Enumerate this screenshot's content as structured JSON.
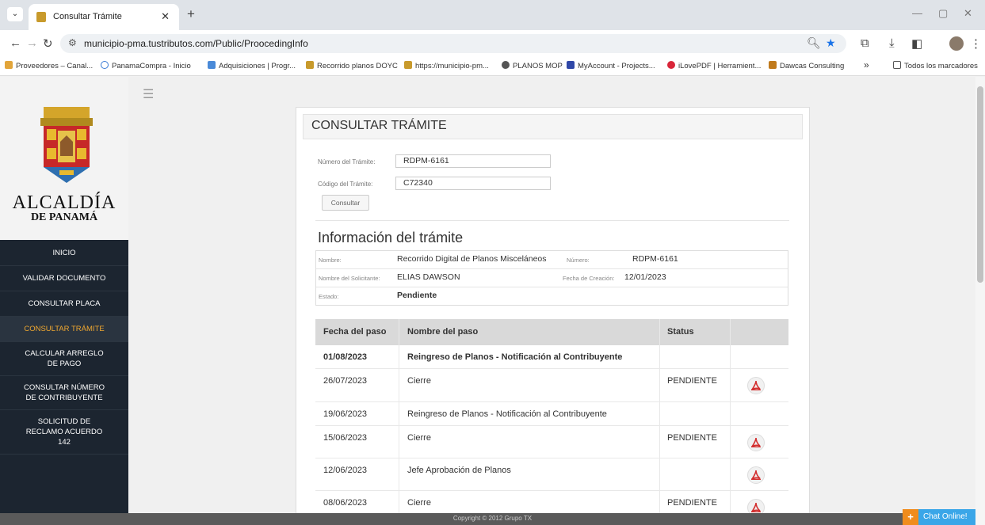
{
  "browser": {
    "tab_title": "Consultar Trámite",
    "url": "municipio-pma.tustributos.com/Public/ProocedingInfo",
    "bookmarks": [
      "Proveedores – Canal...",
      "PanamaCompra - Inicio",
      "Adquisiciones | Progr...",
      "Recorrido planos DOYC",
      "https://municipio-pm...",
      "PLANOS MOP",
      "MyAccount - Projects...",
      "iLovePDF | Herramient...",
      "Dawcas Consulting"
    ],
    "more_bookmarks": "»",
    "all_bookmarks": "Todos los marcadores"
  },
  "logo": {
    "line1": "ALCALDÍA",
    "line2": "DE PANAMÁ"
  },
  "sidebar": {
    "items": [
      "INICIO",
      "VALIDAR DOCUMENTO",
      "CONSULTAR PLACA",
      "CONSULTAR TRÁMITE",
      "CALCULAR ARREGLO DE PAGO",
      "CONSULTAR NÚMERO DE CONTRIBUYENTE",
      "SOLICITUD DE RECLAMO ACUERDO 142"
    ],
    "active_index": 3
  },
  "panel": {
    "title": "CONSULTAR TRÁMITE"
  },
  "form": {
    "numero_label": "Número del Trámite:",
    "numero_value": "RDPM-6161",
    "codigo_label": "Código del Trámite:",
    "codigo_value": "C72340",
    "button": "Consultar"
  },
  "info": {
    "title": "Información del trámite",
    "nombre_label": "Nombre:",
    "nombre_value": "Recorrido Digital de Planos Misceláneos",
    "numero_label": "Número:",
    "numero_value": "RDPM-6161",
    "solicitante_label": "Nombre del Solicitante:",
    "solicitante_value": "ELIAS DAWSON",
    "fecha_label": "Fecha de Creación:",
    "fecha_value": "12/01/2023",
    "estado_label": "Estado:",
    "estado_value": "Pendiente"
  },
  "steps": {
    "headers": [
      "Fecha del paso",
      "Nombre del paso",
      "Status"
    ],
    "rows": [
      {
        "date": "01/08/2023",
        "name": "Reingreso de Planos - Notificación al Contribuyente",
        "status": "",
        "pdf": false,
        "bold": true
      },
      {
        "date": "26/07/2023",
        "name": "Cierre",
        "status": "PENDIENTE",
        "pdf": true,
        "bold": false
      },
      {
        "date": "19/06/2023",
        "name": "Reingreso de Planos - Notificación al Contribuyente",
        "status": "",
        "pdf": false,
        "bold": false
      },
      {
        "date": "15/06/2023",
        "name": "Cierre",
        "status": "PENDIENTE",
        "pdf": true,
        "bold": false
      },
      {
        "date": "12/06/2023",
        "name": "Jefe Aprobación de Planos",
        "status": "",
        "pdf": true,
        "bold": false
      },
      {
        "date": "08/06/2023",
        "name": "Cierre",
        "status": "PENDIENTE",
        "pdf": true,
        "bold": false
      }
    ]
  },
  "footer": {
    "copyright": "Copyright © 2012 Grupo TX"
  },
  "chat": {
    "label": "Chat Online!"
  },
  "colors": {
    "sidebar_bg": "#1c2530",
    "active_item": "#f0a830",
    "chat": "#3aa6e8",
    "pdf_red": "#d32f2f"
  }
}
